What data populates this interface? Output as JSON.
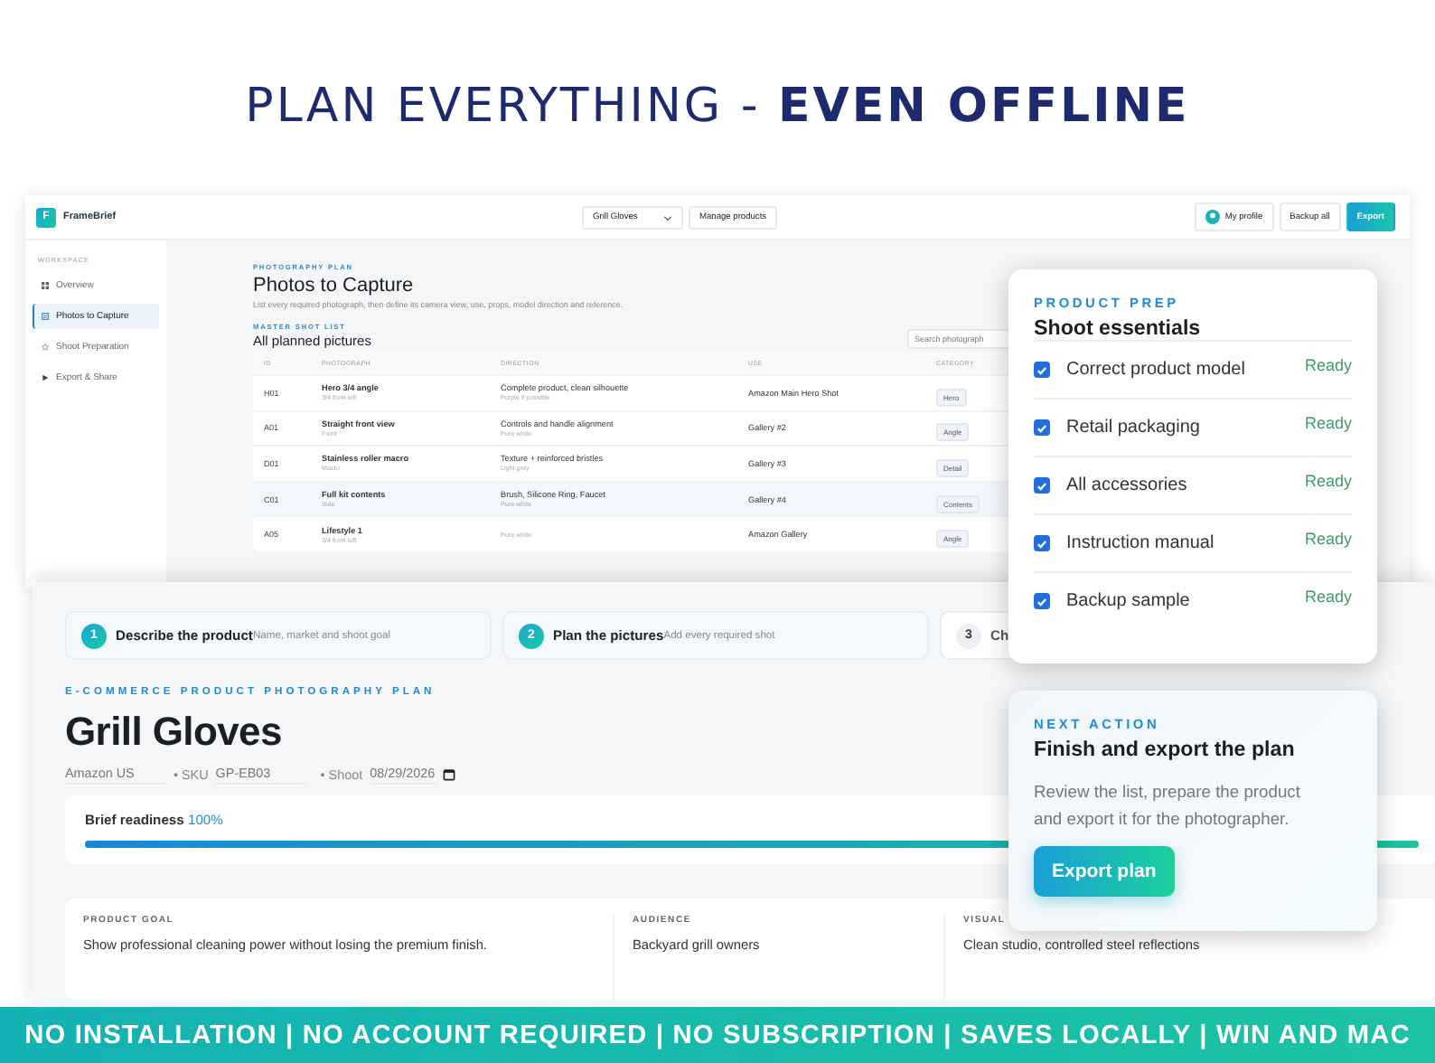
{
  "headline": {
    "text": "PLAN EVERYTHING - **EVEN OFFLINE**"
  },
  "app": {
    "logo_letter": "F",
    "brand": "FrameBrief",
    "product_select": "Grill Gloves",
    "manage_button": "Manage products",
    "profile_button": "My profile",
    "backup_button": "Backup all",
    "export_button": "Export"
  },
  "sidebar": {
    "heading": "WORKSPACE",
    "items": [
      {
        "label": "Overview",
        "kind": "grid",
        "selected": false
      },
      {
        "label": "Photos to Capture",
        "kind": "list",
        "selected": true
      },
      {
        "label": "Shoot Preparation",
        "kind": "star",
        "selected": false
      },
      {
        "label": "Export & Share",
        "kind": "play",
        "selected": false
      }
    ]
  },
  "page": {
    "eyebrow": "PHOTOGRAPHY PLAN",
    "title": "Photos to Capture",
    "description": "List every required photograph, then define its camera view, use, props, model direction and reference.",
    "list_eyebrow": "MASTER SHOT LIST",
    "list_title": "All planned pictures",
    "search": {
      "placeholder": "Search photograph"
    }
  },
  "table": {
    "columns": [
      "ID",
      "PHOTOGRAPH",
      "DIRECTION",
      "USE",
      "CATEGORY"
    ],
    "rows": [
      {
        "id": "H01",
        "photo": "Hero 3/4 angle",
        "photo_note": "3/4 front-left",
        "direction": "Complete product, clean silhouette",
        "direction_note": "Purple if possible",
        "use": "Amazon Main Hero Shot",
        "category": "Hero",
        "selected": false
      },
      {
        "id": "A01",
        "photo": "Straight front view",
        "photo_note": "Front",
        "direction": "Controls and handle alignment",
        "direction_note": "Pure white",
        "use": "Gallery #2",
        "category": "Angle",
        "selected": false
      },
      {
        "id": "D01",
        "photo": "Stainless roller macro",
        "photo_note": "Macro",
        "direction": "Texture + reinforced bristles",
        "direction_note": "Light grey",
        "use": "Gallery #3",
        "category": "Detail",
        "selected": false
      },
      {
        "id": "C01",
        "photo": "Full kit contents",
        "photo_note": "Side",
        "direction": "Brush, Silicone Ring, Faucet",
        "direction_note": "Pure white",
        "use": "Gallery #4",
        "category": "Contents",
        "selected": true
      },
      {
        "id": "A05",
        "photo": "Lifestyle 1",
        "photo_note": "3/4 front-left",
        "direction_note": "Pure white",
        "use": "Amazon Gallery",
        "category": "Angle",
        "selected": false
      }
    ]
  },
  "brief": {
    "steps": [
      {
        "number": "1",
        "title": "Describe the product",
        "hint": "Name, market and shoot goal",
        "done": true
      },
      {
        "number": "2",
        "title": "Plan the pictures",
        "hint": "Add every required shot",
        "done": true
      },
      {
        "number": "3",
        "title": "Ch",
        "done": false
      }
    ],
    "eyebrow": "E-COMMERCE PRODUCT PHOTOGRAPHY PLAN",
    "title": "Grill Gloves",
    "marketplace": "Amazon US",
    "sku_label": "• SKU",
    "sku": "GP-EB03",
    "shoot_label": "• Shoot",
    "shoot_date": "08/29/2026",
    "readiness": {
      "label": "Brief readiness",
      "value": "100%",
      "level": 1
    },
    "fields": [
      {
        "label": "PRODUCT GOAL",
        "value": "Show professional cleaning power without losing the premium finish."
      },
      {
        "label": "AUDIENCE",
        "value": "Backyard grill owners"
      },
      {
        "label": "VISUAL",
        "value": "Clean studio, controlled steel reflections"
      }
    ]
  },
  "prep": {
    "eyebrow": "PRODUCT PREP",
    "title": "Shoot essentials",
    "items": [
      {
        "label": "Correct product model",
        "checked": true,
        "status": "Ready"
      },
      {
        "label": "Retail packaging",
        "checked": true,
        "status": "Ready"
      },
      {
        "label": "All accessories",
        "checked": true,
        "status": "Ready"
      },
      {
        "label": "Instruction manual",
        "checked": true,
        "status": "Ready"
      },
      {
        "label": "Backup sample",
        "checked": true,
        "status": "Ready"
      }
    ]
  },
  "next_action": {
    "eyebrow": "NEXT ACTION",
    "title": "Finish and export the plan",
    "text": "Review the list, prepare the product and export it for the photographer.",
    "button": "Export plan"
  },
  "banner": {
    "text": "NO INSTALLATION | NO ACCOUNT REQUIRED | NO SUBSCRIPTION | SAVES LOCALLY | WIN AND MAC"
  }
}
